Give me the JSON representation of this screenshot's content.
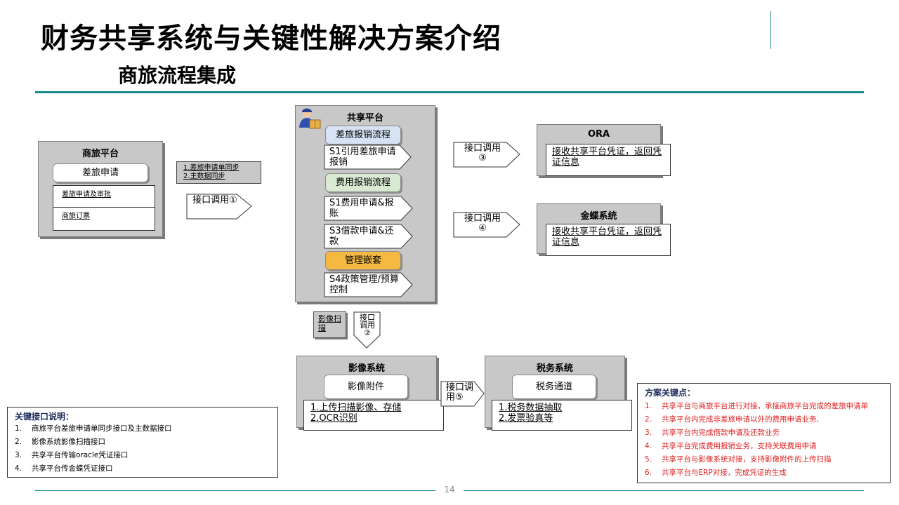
{
  "header": {
    "title": "财务共享系统与关键性解决方案介绍",
    "subtitle": "商旅流程集成"
  },
  "colors": {
    "accent": "#1a8c8c",
    "panel": "#c8c8c8",
    "orange": "#f5b942",
    "green": "#d9ead3",
    "blue": "#d7e3f4",
    "red": "#e02020"
  },
  "icons": {
    "platform": "user-package-icon"
  },
  "travel_platform": {
    "title": "商旅平台",
    "button": "差旅申请",
    "items": [
      "差旅申请及审批",
      "商旅订票"
    ]
  },
  "sync_box": {
    "lines": [
      "1.差旅申请单同步",
      "2.主数据同步"
    ]
  },
  "shared_platform": {
    "title": "共享平台",
    "sections": [
      {
        "label": "差旅报销流程",
        "steps": [
          "S1引用差旅申请报销"
        ]
      },
      {
        "label": "费用报销流程",
        "steps": [
          "S1费用申请&报账",
          "S3借款申请&还款"
        ]
      },
      {
        "label": "管理嵌套",
        "steps": [
          "S4政策管理/预算控制"
        ]
      }
    ]
  },
  "interfaces": {
    "i1": "接口调用①",
    "i2": "接口调用②",
    "i3": "接口调用③",
    "i4": "接口调用④",
    "i5": "接口调用⑤",
    "scan": "影像扫描"
  },
  "ora": {
    "title": "ORA",
    "text": "接收共享平台凭证，返回凭证信息"
  },
  "kingdee": {
    "title": "金蝶系统",
    "text": "接收共享平台凭证，返回凭证信息"
  },
  "image_system": {
    "title": "影像系统",
    "button": "影像附件",
    "lines": [
      "1.上传扫描影像、存储",
      "2.OCR识别"
    ]
  },
  "tax_system": {
    "title": "税务系统",
    "button": "税务通道",
    "lines": [
      "1.税务数据抽取",
      "2.发票验真等"
    ]
  },
  "key_interfaces": {
    "title": "关键接口说明：",
    "items": [
      "商旅平台差旅申请单同步接口及主数据接口",
      "影像系统影像扫描接口",
      "共享平台传输oracle凭证接口",
      "共享平台传金蝶凭证接口"
    ]
  },
  "solution_points": {
    "title": "方案关键点：",
    "items": [
      "共享平台与商旅平台进行对接，承接商旅平台完成的差旅申请单",
      "共享平台内完成非差旅申请以外的费用申请业务,",
      "共享平台内完成借款申请及还款业务",
      "共享平台完成费用报销业务，支持关联费用申请",
      "共享平台与影像系统对接，支持影像附件的上传扫描",
      "共享平台与ERP对接，完成凭证的生成"
    ]
  },
  "page_number": "14"
}
